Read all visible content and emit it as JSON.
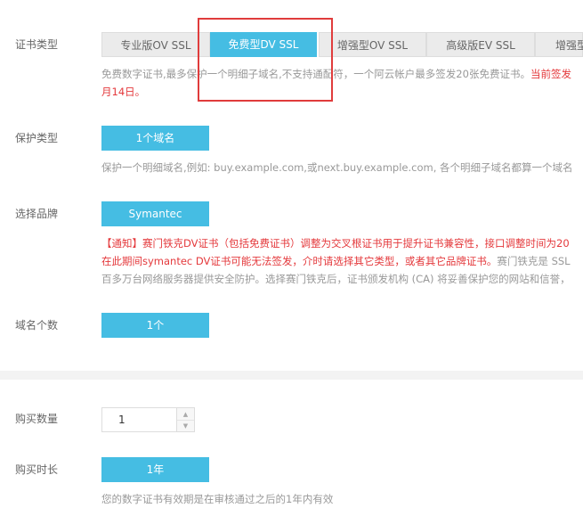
{
  "cert_type": {
    "label": "证书类型",
    "tabs": [
      {
        "label": "专业版OV SSL",
        "selected": false
      },
      {
        "label": "免费型DV SSL",
        "selected": true
      },
      {
        "label": "增强型OV SSL",
        "selected": false
      },
      {
        "label": "高级版EV SSL",
        "selected": false
      },
      {
        "label": "增强型",
        "selected": false
      }
    ],
    "desc_line1": "免费数字证书,最多保护一个明细子域名,不支持通配符，一个阿云帐户最多签发20张免费证书。",
    "desc_line1_red": "当前签发",
    "desc_line2_red": "月14日。"
  },
  "protect_type": {
    "label": "保护类型",
    "button": "1个域名",
    "hint": "保护一个明细域名,例如: buy.example.com,或next.buy.example.com, 各个明细子域名都算一个域名"
  },
  "brand": {
    "label": "选择品牌",
    "button": "Symantec",
    "notice_line1": "【通知】赛门铁克DV证书（包括免费证书）调整为交叉根证书用于提升证书兼容性，接口调整时间为20",
    "notice_line2_red": "在此期间symantec DV证书可能无法签发，介时请选择其它类型，或者其它品牌证书。",
    "notice_line2_gray": "赛门铁克是 SSL",
    "notice_line3": "百多万台网络服务器提供安全防护。选择赛门铁克后，证书颁发机构 (CA) 将妥善保护您的网站和信誉，"
  },
  "domain_count": {
    "label": "域名个数",
    "button": "1个"
  },
  "quantity": {
    "label": "购买数量",
    "value": "1"
  },
  "duration": {
    "label": "购买时长",
    "button": "1年",
    "hint": "您的数字证书有效期是在审核通过之后的1年内有效"
  },
  "colors": {
    "accent": "#45bde3",
    "highlight_box": "#e03c3c",
    "notice_red": "#e4393c"
  }
}
